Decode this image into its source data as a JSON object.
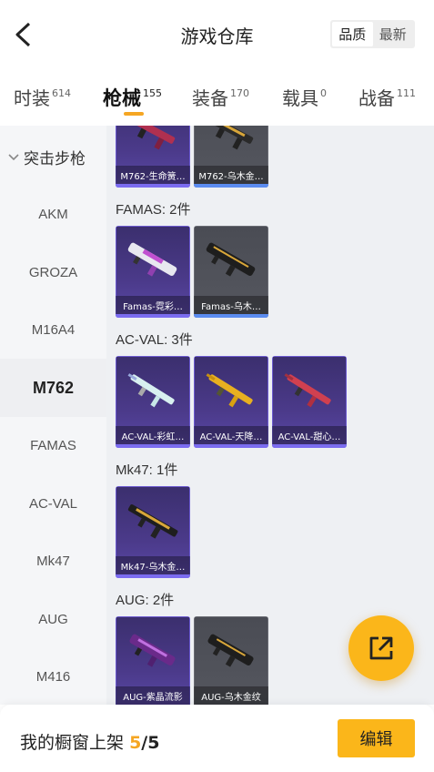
{
  "header": {
    "title": "游戏仓库",
    "sort_options": [
      "品质",
      "最新"
    ]
  },
  "tabs": [
    {
      "label": "时装",
      "count": "614"
    },
    {
      "label": "枪械",
      "count": "155"
    },
    {
      "label": "装备",
      "count": "170"
    },
    {
      "label": "载具",
      "count": "0"
    },
    {
      "label": "战备",
      "count": "111"
    }
  ],
  "sidebar": {
    "category": "突击步枪",
    "items": [
      "AKM",
      "GROZA",
      "M16A4",
      "M762",
      "FAMAS",
      "AC-VAL",
      "Mk47",
      "AUG",
      "M416"
    ]
  },
  "groups": {
    "m762": {
      "cards": [
        "M762-生命簧…",
        "M762-乌木金…"
      ]
    },
    "famas": {
      "title": "FAMAS: 2件",
      "cards": [
        "Famas-霓彩…",
        "Famas-乌木…"
      ]
    },
    "acval": {
      "title": "AC-VAL: 3件",
      "cards": [
        "AC-VAL-彩虹…",
        "AC-VAL-天降…",
        "AC-VAL-甜心…"
      ]
    },
    "mk47": {
      "title": "Mk47: 1件",
      "cards": [
        "Mk47-乌木金…"
      ]
    },
    "aug": {
      "title": "AUG: 2件",
      "cards": [
        "AUG-紫晶流影",
        "AUG-乌木金纹"
      ]
    }
  },
  "bottom": {
    "label": "我的橱窗上架",
    "count": "5",
    "separator": "/",
    "total": "5",
    "edit_label": "编辑"
  },
  "colors": {
    "accent": "#fbb61a",
    "card_purple": "#4b3a8a",
    "card_gray": "#55575f"
  }
}
